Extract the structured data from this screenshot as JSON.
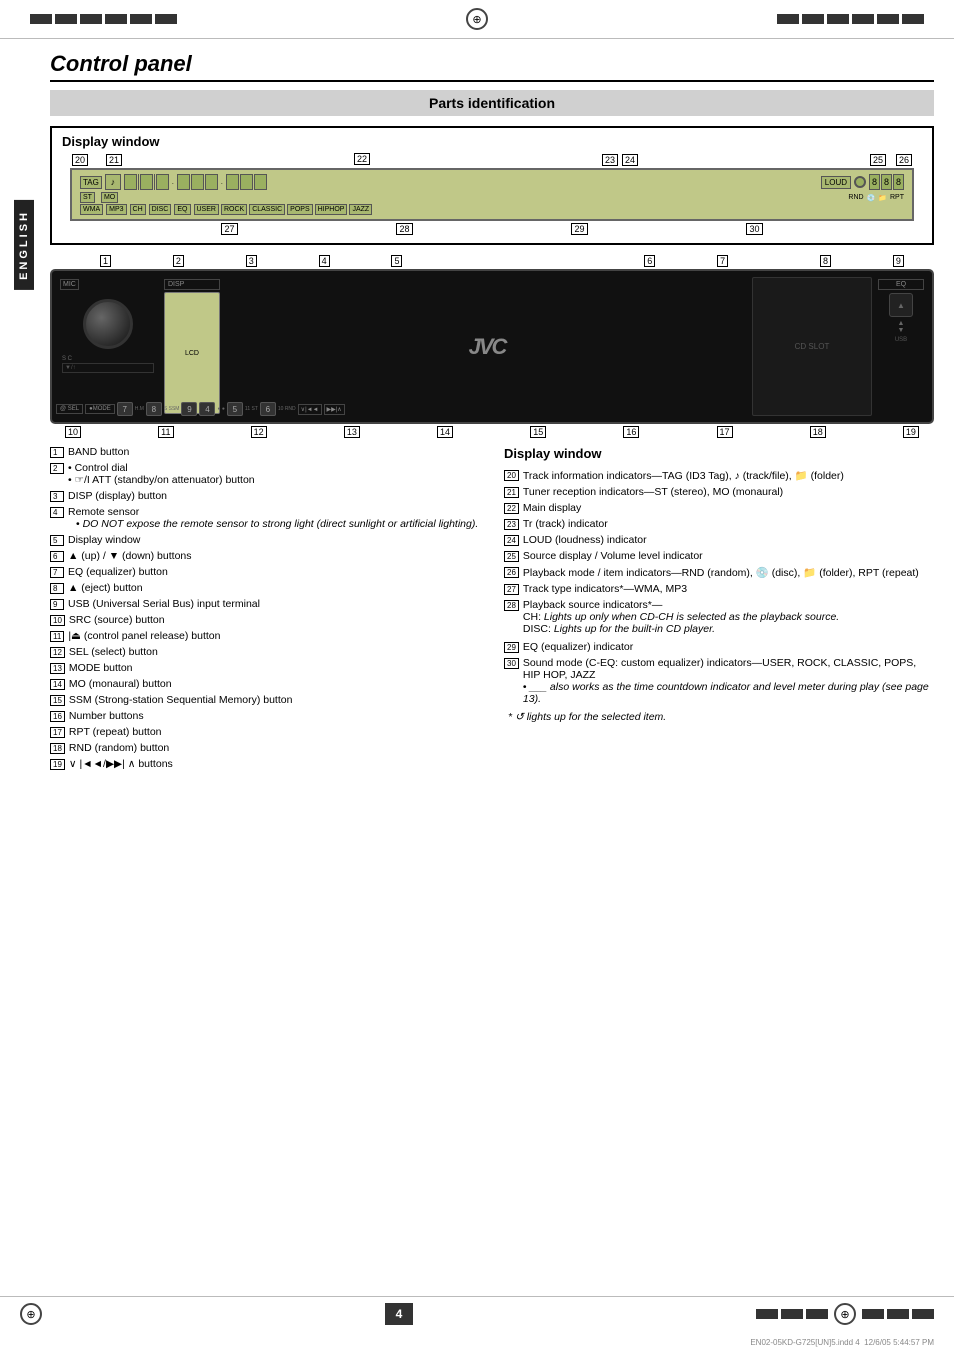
{
  "page": {
    "title": "Control panel",
    "section": "Parts identification",
    "display_window_label": "Display window",
    "page_number": "4",
    "file_info": "EN02-05KD-G725[UN]5.indd  4",
    "date_info": "12/6/05  5:44:57 PM",
    "language_sidebar": "ENGLISH"
  },
  "display_numbers_top": [
    "20",
    "21",
    "22",
    "23",
    "24",
    "25",
    "26"
  ],
  "display_numbers_bottom_top": [
    "27",
    "28",
    "29",
    "30"
  ],
  "device_numbers_top": [
    "1",
    "2",
    "3",
    "4",
    "5",
    "6",
    "7",
    "8",
    "9"
  ],
  "device_numbers_bottom": [
    "10",
    "11",
    "12",
    "13",
    "14",
    "15",
    "16",
    "17",
    "18",
    "19"
  ],
  "left_items": [
    {
      "num": "1",
      "text": "BAND button"
    },
    {
      "num": "2",
      "text": "• Control dial\n• ☞/I ATT (standby/on attenuator) button"
    },
    {
      "num": "3",
      "text": "DISP (display) button"
    },
    {
      "num": "4",
      "text": "Remote sensor\n• DO NOT expose the remote sensor to strong light (direct sunlight or artificial lighting)."
    },
    {
      "num": "5",
      "text": "Display window"
    },
    {
      "num": "6",
      "text": "▲ (up) / ▼ (down) buttons"
    },
    {
      "num": "7",
      "text": "EQ (equalizer) button"
    },
    {
      "num": "8",
      "text": "▲ (eject) button"
    },
    {
      "num": "9",
      "text": "USB (Universal Serial Bus) input terminal"
    },
    {
      "num": "10",
      "text": "SRC (source) button"
    },
    {
      "num": "11",
      "text": "|⏏ (control panel release) button"
    },
    {
      "num": "12",
      "text": "SEL (select) button"
    },
    {
      "num": "13",
      "text": "MODE button"
    },
    {
      "num": "14",
      "text": "MO (monaural) button"
    },
    {
      "num": "15",
      "text": "SSM (Strong-station Sequential Memory) button"
    },
    {
      "num": "16",
      "text": "Number buttons"
    },
    {
      "num": "17",
      "text": "RPT (repeat) button"
    },
    {
      "num": "18",
      "text": "RND (random) button"
    },
    {
      "num": "19",
      "text": "∨ |◄◄/►►| ∧ buttons"
    }
  ],
  "right_header": "Display window",
  "right_items": [
    {
      "num": "20",
      "text": "Track information indicators—TAG (ID3 Tag), 🎵 (track/file), 📁 (folder)"
    },
    {
      "num": "21",
      "text": "Tuner reception indicators—ST (stereo), MO (monaural)"
    },
    {
      "num": "22",
      "text": "Main display"
    },
    {
      "num": "23",
      "text": "Tr (track) indicator"
    },
    {
      "num": "24",
      "text": "LOUD (loudness) indicator"
    },
    {
      "num": "25",
      "text": "Source display / Volume level indicator"
    },
    {
      "num": "26",
      "text": "Playback mode / item indicators—RND (random), 💿 (disc), 📁 (folder), RPT (repeat)"
    },
    {
      "num": "27",
      "text": "Track type indicators*—WMA, MP3"
    },
    {
      "num": "28",
      "text": "Playback source indicators*—CH: Lights up only when CD-CH is selected as the playback source.\nDISC: Lights up for the built-in CD player."
    },
    {
      "num": "29",
      "text": "EQ (equalizer) indicator"
    },
    {
      "num": "30",
      "text": "Sound mode (C-EQ: custom equalizer) indicators—USER, ROCK, CLASSIC, POPS, HIP HOP, JAZZ\n• ___ also works as the time countdown indicator and level meter during play (see page 13)."
    },
    {
      "num": "*",
      "text": "🔄 lights up for the selected item."
    }
  ]
}
